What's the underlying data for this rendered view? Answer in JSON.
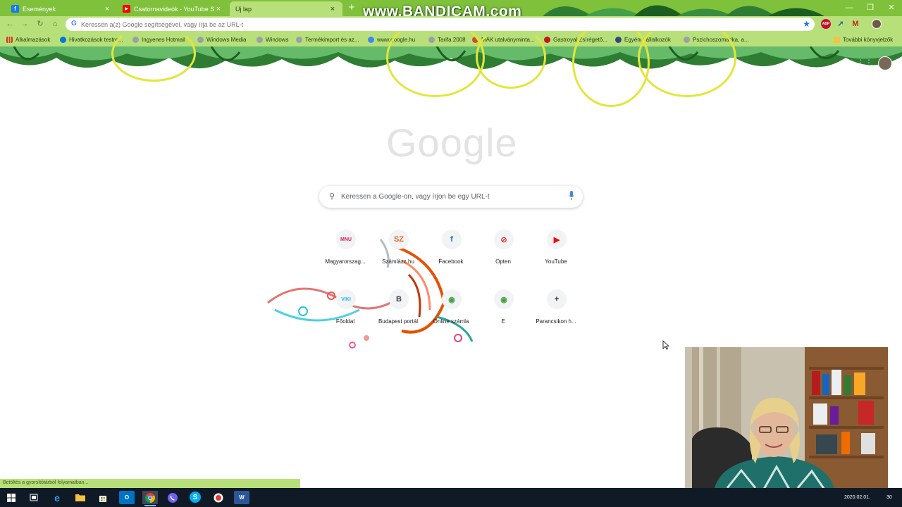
{
  "tabs": [
    {
      "title": "Események",
      "favicon": "facebook-icon",
      "color": "#1877f2",
      "glyph": "f"
    },
    {
      "title": "Csatornavideók - YouTube Studio",
      "favicon": "youtube-icon",
      "color": "#ff0000",
      "glyph": "▶"
    },
    {
      "title": "Új lap",
      "favicon": "",
      "color": "",
      "glyph": ""
    }
  ],
  "watermark": "www.BANDICAM.com",
  "omnibox": {
    "placeholder": "Keressen a(z) Google segítségével, vagy írja be az URL-t"
  },
  "extensions": [
    {
      "name": "adblock-icon",
      "glyph": "ABP",
      "color": "#c70d2c"
    },
    {
      "name": "extension-arrow-icon",
      "glyph": "➚",
      "color": "#2b6cb0"
    },
    {
      "name": "gmail-icon",
      "glyph": "M",
      "color": "#c5221f"
    },
    {
      "name": "profile-avatar-icon",
      "glyph": "",
      "color": "#6d5a48"
    }
  ],
  "bookmarks": {
    "apps": "Alkalmazások",
    "items": [
      {
        "label": "Hivatkozások testre...",
        "color": "#0078d7"
      },
      {
        "label": "Ingyenes Hotmail",
        "color": "#9aa0a6"
      },
      {
        "label": "Windows Media",
        "color": "#9aa0a6"
      },
      {
        "label": "Windows",
        "color": "#9aa0a6"
      },
      {
        "label": "Termékimport és az...",
        "color": "#9aa0a6"
      },
      {
        "label": "www.google.hu",
        "color": "#4285f4"
      },
      {
        "label": "Tarifa 2008",
        "color": "#9aa0a6"
      },
      {
        "label": "MÁK utalványminta...",
        "color": "#d24c2c"
      },
      {
        "label": "Gastroyal Zsírégető...",
        "color": "#c4161c"
      },
      {
        "label": "Egyéni vállalkozók",
        "color": "#2e4a7d"
      },
      {
        "label": "Pszichoszomatika, a...",
        "color": "#9aa0a6"
      }
    ],
    "other": "További könyvjelzők"
  },
  "logo": "Google",
  "search": {
    "placeholder": "Keressen a Google-on, vagy írjon be egy URL-t"
  },
  "shortcuts": [
    {
      "label": "Magyarorszag...",
      "icon": "mnu-icon",
      "glyph": "MNU",
      "color": "#d81b60"
    },
    {
      "label": "Számlázz.hu",
      "icon": "szamlazz-icon",
      "glyph": "SZ",
      "color": "#f26522"
    },
    {
      "label": "Facebook",
      "icon": "facebook-icon",
      "glyph": "f",
      "color": "#1877f2"
    },
    {
      "label": "Opten",
      "icon": "opten-icon",
      "glyph": "⊘",
      "color": "#e53935"
    },
    {
      "label": "YouTube",
      "icon": "youtube-icon",
      "glyph": "▶",
      "color": "#ff0000"
    },
    {
      "label": "Főoldal",
      "icon": "viki-icon",
      "glyph": "VIKI",
      "color": "#29b6f6"
    },
    {
      "label": "Budapest portál",
      "icon": "budapest-portal-icon",
      "glyph": "B",
      "color": "#37474f"
    },
    {
      "label": "Online számla",
      "icon": "online-szamla-icon",
      "glyph": "◉",
      "color": "#43a047"
    },
    {
      "label": "E",
      "icon": "e-icon",
      "glyph": "◉",
      "color": "#43a047"
    },
    {
      "label": "Parancsikon h...",
      "icon": "add-shortcut-icon",
      "glyph": "+",
      "color": "#202124"
    }
  ],
  "status": "Betöltés a gyorsítótárból folyamatban...",
  "clock": {
    "date": "2020.02.01.",
    "time": "30"
  }
}
